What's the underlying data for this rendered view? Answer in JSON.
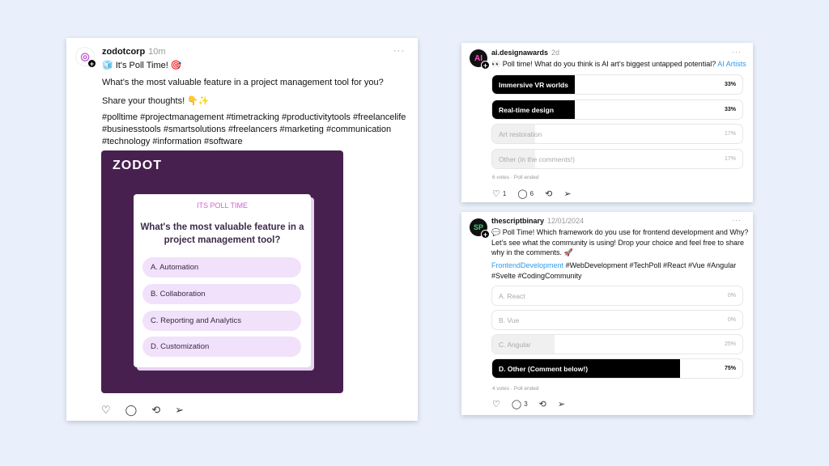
{
  "post1": {
    "username": "zodotcorp",
    "time": "10m",
    "title": "🧊 It's Poll Time! 🎯",
    "question": "What’s the most valuable feature in a project management tool for you?",
    "cta": "Share your thoughts! 👇✨",
    "hashtags": [
      "#polltime #projectmanagement #timetracking #productivitytools #freelancelife",
      "#businesstools #smartsolutions #freelancers #marketing #communication",
      "#technology #information #software"
    ],
    "image": {
      "logo": "ZODOT",
      "tag": "ITS POLL TIME",
      "question": "What's the most valuable feature in a project management tool?",
      "options": [
        "A.  Automation",
        "B.  Collaboration",
        "C.  Reporting and Analytics",
        "D.  Customization"
      ],
      "bg_color": "#48204f",
      "option_color": "#f1e1fb"
    },
    "actions": [
      "heart-icon",
      "comment-icon",
      "repost-icon",
      "share-icon"
    ]
  },
  "post2": {
    "username": "ai.designawards",
    "time": "2d",
    "text": "👀 Poll time! What do you think is AI art’s biggest untapped potential?",
    "link": "AI Artists",
    "options": [
      {
        "label": "Immersive VR worlds",
        "percent": 33,
        "winner": true
      },
      {
        "label": "Real-time design",
        "percent": 33,
        "winner": true
      },
      {
        "label": "Art restoration",
        "percent": 17,
        "winner": false
      },
      {
        "label": "Other (in the comments!)",
        "percent": 17,
        "winner": false
      }
    ],
    "pct_labels": [
      "33%",
      "33%",
      "17%",
      "17%"
    ],
    "status": "6 votes · Poll ended",
    "likes": "1",
    "comments": "6"
  },
  "post3": {
    "username": "thescriptbinary",
    "time": "12/01/2024",
    "text": [
      "💬 Poll Time! Which framework do you use for frontend development and Why?",
      "Let’s see what the community is using! Drop your choice and feel free to share",
      "why in the comments. 🚀"
    ],
    "link": "FrontendDevelopment",
    "hashtags1": " #WebDevelopment #TechPoll #React #Vue #Angular",
    "hashtags2": "#Svelte #CodingCommunity",
    "options": [
      {
        "label": "A. React",
        "percent": 0,
        "winner": false
      },
      {
        "label": "B. Vue",
        "percent": 0,
        "winner": false
      },
      {
        "label": "C. Angular",
        "percent": 25,
        "winner": false
      },
      {
        "label": "D. Other (Comment below!)",
        "percent": 75,
        "winner": true
      }
    ],
    "pct_labels": [
      "0%",
      "0%",
      "25%",
      "75%"
    ],
    "status": "4 votes · Poll ended",
    "comments": "3"
  },
  "more": "···"
}
